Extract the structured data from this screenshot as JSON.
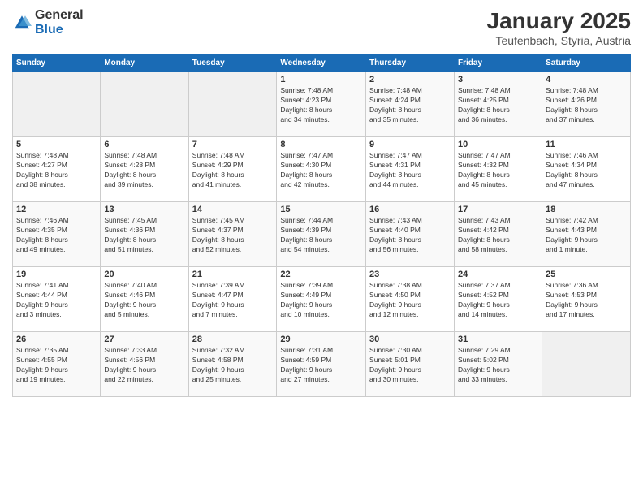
{
  "logo": {
    "general": "General",
    "blue": "Blue"
  },
  "header": {
    "month": "January 2025",
    "location": "Teufenbach, Styria, Austria"
  },
  "weekdays": [
    "Sunday",
    "Monday",
    "Tuesday",
    "Wednesday",
    "Thursday",
    "Friday",
    "Saturday"
  ],
  "weeks": [
    [
      {
        "day": "",
        "info": ""
      },
      {
        "day": "",
        "info": ""
      },
      {
        "day": "",
        "info": ""
      },
      {
        "day": "1",
        "info": "Sunrise: 7:48 AM\nSunset: 4:23 PM\nDaylight: 8 hours\nand 34 minutes."
      },
      {
        "day": "2",
        "info": "Sunrise: 7:48 AM\nSunset: 4:24 PM\nDaylight: 8 hours\nand 35 minutes."
      },
      {
        "day": "3",
        "info": "Sunrise: 7:48 AM\nSunset: 4:25 PM\nDaylight: 8 hours\nand 36 minutes."
      },
      {
        "day": "4",
        "info": "Sunrise: 7:48 AM\nSunset: 4:26 PM\nDaylight: 8 hours\nand 37 minutes."
      }
    ],
    [
      {
        "day": "5",
        "info": "Sunrise: 7:48 AM\nSunset: 4:27 PM\nDaylight: 8 hours\nand 38 minutes."
      },
      {
        "day": "6",
        "info": "Sunrise: 7:48 AM\nSunset: 4:28 PM\nDaylight: 8 hours\nand 39 minutes."
      },
      {
        "day": "7",
        "info": "Sunrise: 7:48 AM\nSunset: 4:29 PM\nDaylight: 8 hours\nand 41 minutes."
      },
      {
        "day": "8",
        "info": "Sunrise: 7:47 AM\nSunset: 4:30 PM\nDaylight: 8 hours\nand 42 minutes."
      },
      {
        "day": "9",
        "info": "Sunrise: 7:47 AM\nSunset: 4:31 PM\nDaylight: 8 hours\nand 44 minutes."
      },
      {
        "day": "10",
        "info": "Sunrise: 7:47 AM\nSunset: 4:32 PM\nDaylight: 8 hours\nand 45 minutes."
      },
      {
        "day": "11",
        "info": "Sunrise: 7:46 AM\nSunset: 4:34 PM\nDaylight: 8 hours\nand 47 minutes."
      }
    ],
    [
      {
        "day": "12",
        "info": "Sunrise: 7:46 AM\nSunset: 4:35 PM\nDaylight: 8 hours\nand 49 minutes."
      },
      {
        "day": "13",
        "info": "Sunrise: 7:45 AM\nSunset: 4:36 PM\nDaylight: 8 hours\nand 51 minutes."
      },
      {
        "day": "14",
        "info": "Sunrise: 7:45 AM\nSunset: 4:37 PM\nDaylight: 8 hours\nand 52 minutes."
      },
      {
        "day": "15",
        "info": "Sunrise: 7:44 AM\nSunset: 4:39 PM\nDaylight: 8 hours\nand 54 minutes."
      },
      {
        "day": "16",
        "info": "Sunrise: 7:43 AM\nSunset: 4:40 PM\nDaylight: 8 hours\nand 56 minutes."
      },
      {
        "day": "17",
        "info": "Sunrise: 7:43 AM\nSunset: 4:42 PM\nDaylight: 8 hours\nand 58 minutes."
      },
      {
        "day": "18",
        "info": "Sunrise: 7:42 AM\nSunset: 4:43 PM\nDaylight: 9 hours\nand 1 minute."
      }
    ],
    [
      {
        "day": "19",
        "info": "Sunrise: 7:41 AM\nSunset: 4:44 PM\nDaylight: 9 hours\nand 3 minutes."
      },
      {
        "day": "20",
        "info": "Sunrise: 7:40 AM\nSunset: 4:46 PM\nDaylight: 9 hours\nand 5 minutes."
      },
      {
        "day": "21",
        "info": "Sunrise: 7:39 AM\nSunset: 4:47 PM\nDaylight: 9 hours\nand 7 minutes."
      },
      {
        "day": "22",
        "info": "Sunrise: 7:39 AM\nSunset: 4:49 PM\nDaylight: 9 hours\nand 10 minutes."
      },
      {
        "day": "23",
        "info": "Sunrise: 7:38 AM\nSunset: 4:50 PM\nDaylight: 9 hours\nand 12 minutes."
      },
      {
        "day": "24",
        "info": "Sunrise: 7:37 AM\nSunset: 4:52 PM\nDaylight: 9 hours\nand 14 minutes."
      },
      {
        "day": "25",
        "info": "Sunrise: 7:36 AM\nSunset: 4:53 PM\nDaylight: 9 hours\nand 17 minutes."
      }
    ],
    [
      {
        "day": "26",
        "info": "Sunrise: 7:35 AM\nSunset: 4:55 PM\nDaylight: 9 hours\nand 19 minutes."
      },
      {
        "day": "27",
        "info": "Sunrise: 7:33 AM\nSunset: 4:56 PM\nDaylight: 9 hours\nand 22 minutes."
      },
      {
        "day": "28",
        "info": "Sunrise: 7:32 AM\nSunset: 4:58 PM\nDaylight: 9 hours\nand 25 minutes."
      },
      {
        "day": "29",
        "info": "Sunrise: 7:31 AM\nSunset: 4:59 PM\nDaylight: 9 hours\nand 27 minutes."
      },
      {
        "day": "30",
        "info": "Sunrise: 7:30 AM\nSunset: 5:01 PM\nDaylight: 9 hours\nand 30 minutes."
      },
      {
        "day": "31",
        "info": "Sunrise: 7:29 AM\nSunset: 5:02 PM\nDaylight: 9 hours\nand 33 minutes."
      },
      {
        "day": "",
        "info": ""
      }
    ]
  ]
}
